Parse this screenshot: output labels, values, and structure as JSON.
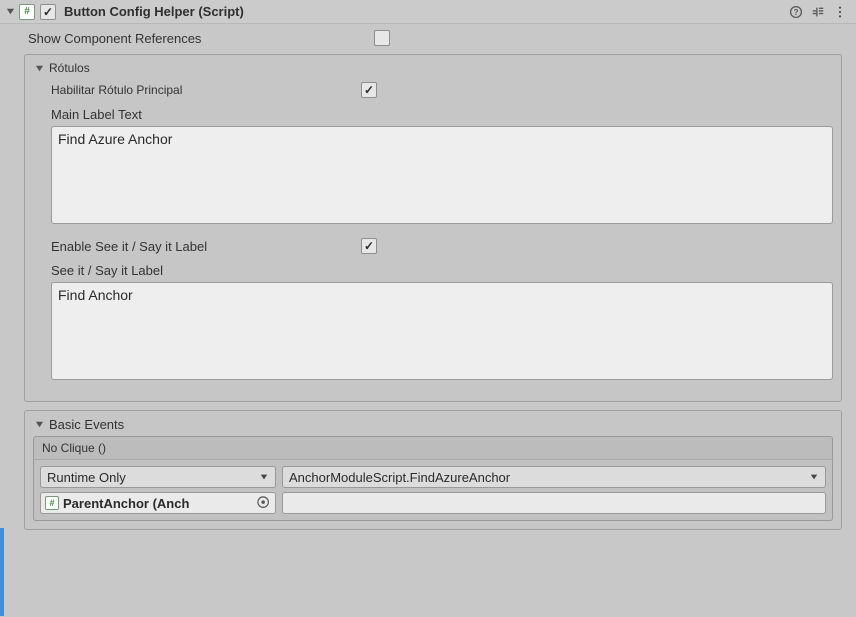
{
  "header": {
    "title": "Button Config Helper (Script)",
    "enabled": true
  },
  "rows": {
    "show_refs_label": "Show Component References",
    "show_refs_checked": false
  },
  "labels_box": {
    "title": "Rótulos",
    "enable_main_label": "Habilitar Rótulo Principal",
    "enable_main_checked": true,
    "main_text_label": "Main Label Text",
    "main_text_value": "Find Azure Anchor",
    "enable_seeit_label": "Enable See it / Say it Label",
    "enable_seeit_checked": true,
    "seeit_label": "See it / Say it Label",
    "seeit_value": "Find Anchor"
  },
  "events_box": {
    "title": "Basic Events",
    "event_name": "No Clique ()",
    "runtime_mode": "Runtime Only",
    "function_path": "AnchorModuleScript.FindAzureAnchor",
    "target_object": "ParentAnchor (Anch",
    "string_arg": ""
  }
}
